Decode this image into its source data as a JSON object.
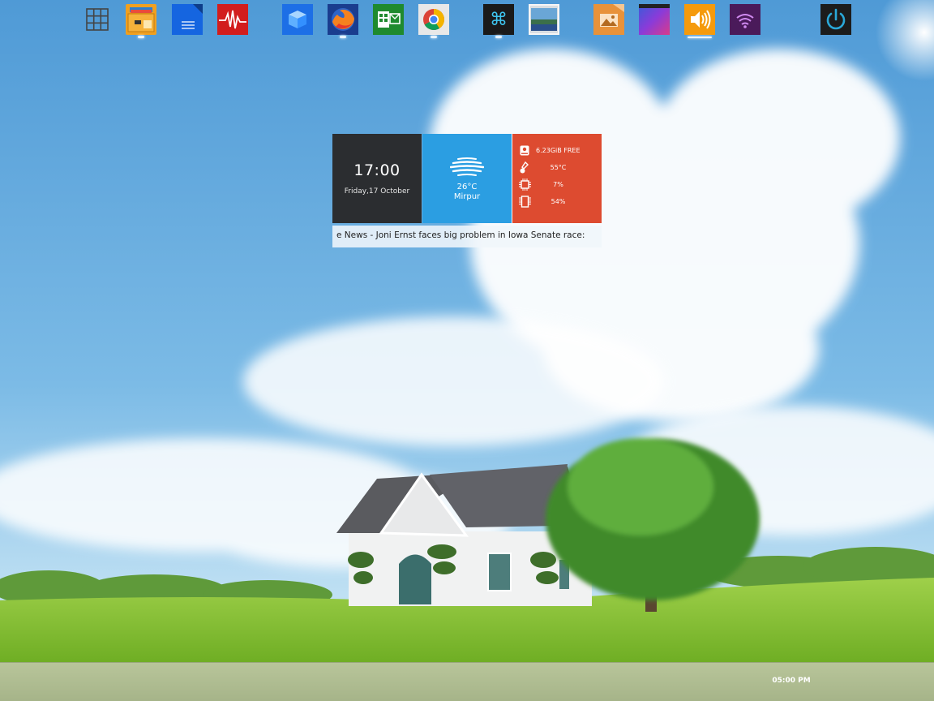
{
  "widgets": {
    "clock": {
      "time": "17:00",
      "date": "Friday,17 October"
    },
    "weather": {
      "temperature": "26°C",
      "city": "Mirpur"
    },
    "system": {
      "disk": "6.23GiB FREE",
      "temperature": "55°C",
      "cpu": "7%",
      "memory": "54%"
    },
    "news": "e News - Joni Ernst faces big problem in Iowa Senate race:"
  },
  "dock": {
    "clock": "05:00 PM",
    "items": [
      "app-grid-icon",
      "file-manager-icon",
      "document-icon",
      "system-monitor-icon",
      "virtualbox-icon",
      "firefox-icon",
      "office-icon",
      "chrome-icon",
      "command-icon",
      "image-viewer-icon",
      "pictures-folder-icon",
      "desktop-theme-icon",
      "volume-icon",
      "wifi-icon",
      "power-icon"
    ]
  },
  "colors": {
    "clock_tile": "#2b2d30",
    "weather_tile": "#2b9ee2",
    "system_tile": "#dd4b30",
    "dock": "#b0bd93"
  }
}
